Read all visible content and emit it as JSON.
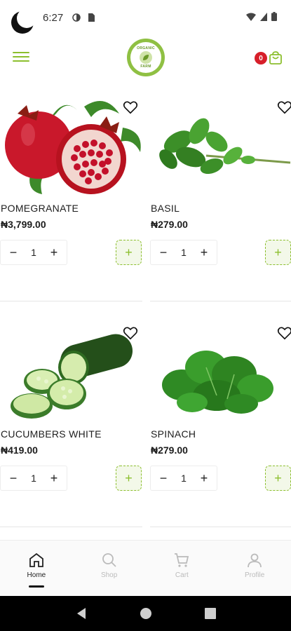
{
  "status": {
    "time": "6:27"
  },
  "header": {
    "cart_count": "0"
  },
  "products": [
    {
      "name": "POMEGRANATE",
      "price": "₦3,799.00",
      "qty": "1"
    },
    {
      "name": "BASIL",
      "price": "₦279.00",
      "qty": "1"
    },
    {
      "name": "CUCUMBERS WHITE",
      "price": "₦419.00",
      "qty": "1"
    },
    {
      "name": "SPINACH",
      "price": "₦279.00",
      "qty": "1"
    }
  ],
  "nav": [
    {
      "label": "Home",
      "icon": "home-icon",
      "active": true
    },
    {
      "label": "Shop",
      "icon": "search-icon",
      "active": false
    },
    {
      "label": "Cart",
      "icon": "cart-icon",
      "active": false
    },
    {
      "label": "Profile",
      "icon": "profile-icon",
      "active": false
    }
  ],
  "colors": {
    "accent": "#8cbf2e",
    "badge": "#d71f2a"
  }
}
